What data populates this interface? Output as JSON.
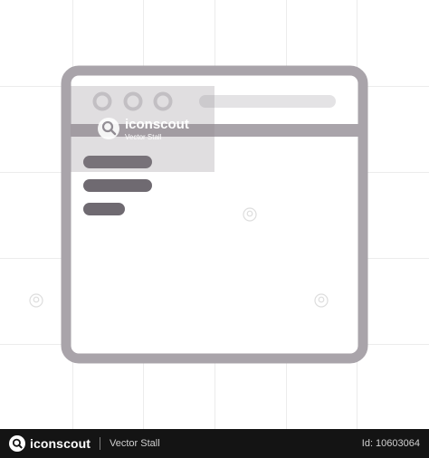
{
  "watermark": {
    "brand": "iconscout",
    "contributor": "Vector Stall"
  },
  "footer": {
    "brand": "iconscout",
    "contributor": "Vector Stall",
    "asset_id": "Id: 10603064"
  },
  "colors": {
    "background": "#ffffff",
    "grid": "#ececec",
    "window_frame": "#a9a4aa",
    "window_fill": "#ffffff",
    "dot_outline": "#d6d4d7",
    "address_bar": "#e4e3e5",
    "header_band": "#a9a4aa",
    "sidebar_lines": "#6f6a71",
    "footer_bg": "#141414"
  },
  "icons": [
    "browser-window-icon",
    "iconscout-logo-icon",
    "watermark-logo-icon"
  ]
}
